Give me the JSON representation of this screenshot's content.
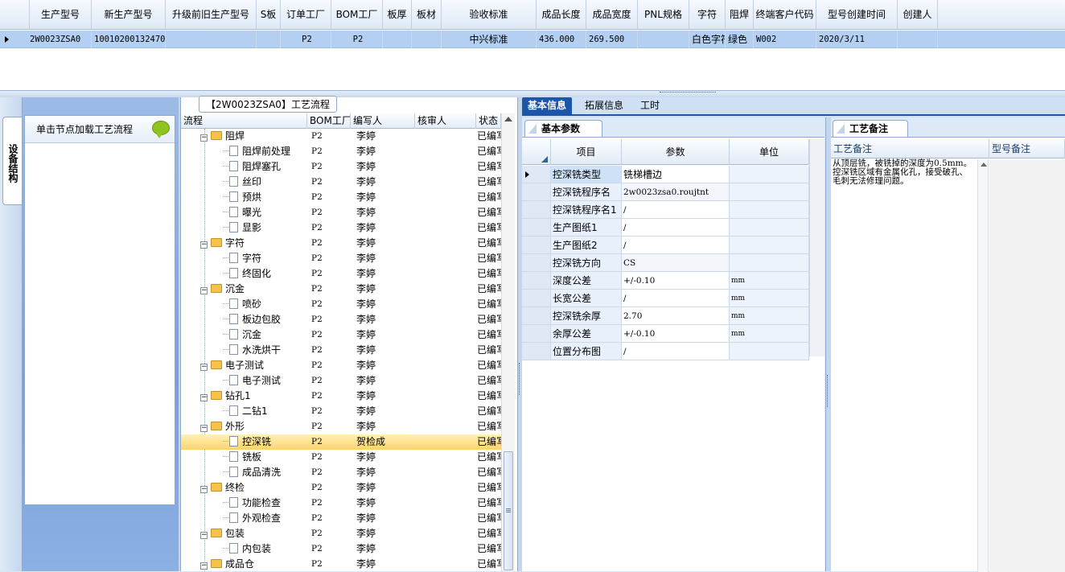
{
  "top_grid": {
    "columns": [
      "生产型号",
      "新生产型号",
      "升级前旧生产型号",
      "S板",
      "订单工厂",
      "BOM工厂",
      "板厚",
      "板材",
      "验收标准",
      "成品长度",
      "成品宽度",
      "PNL规格",
      "字符",
      "阻焊",
      "终端客户代码",
      "型号创建时间",
      "创建人"
    ],
    "row": {
      "production_model": "2W0023ZSA0",
      "new_production_model": "10010200132470",
      "old_production_model": "",
      "s_board": "",
      "order_factory": "P2",
      "bom_factory": "P2",
      "thickness": "",
      "material": "",
      "acceptance_standard": "中兴标准",
      "length": "436.000",
      "width": "269.500",
      "pnl_spec": "",
      "legend": "白色字符",
      "solder_mask": "绿色",
      "customer_code": "W002",
      "created_time": "2020/3/11",
      "creator": ""
    }
  },
  "left_strip": {
    "tab_label": "设备结构"
  },
  "left_panel": {
    "header": "单击节点加载工艺流程"
  },
  "tree": {
    "caption": "【2W0023ZSA0】工艺流程",
    "columns": [
      "流程",
      "BOM工厂",
      "编写人",
      "核审人",
      "状态"
    ],
    "rows": [
      {
        "name": "阻焊",
        "level": 1,
        "bom": "P2",
        "writer": "李婷",
        "reviewer": "",
        "status": "已编写"
      },
      {
        "name": "阻焊前处理",
        "level": 2,
        "bom": "P2",
        "writer": "李婷",
        "reviewer": "",
        "status": "已编写"
      },
      {
        "name": "阻焊塞孔",
        "level": 2,
        "bom": "P2",
        "writer": "李婷",
        "reviewer": "",
        "status": "已编写"
      },
      {
        "name": "丝印",
        "level": 2,
        "bom": "P2",
        "writer": "李婷",
        "reviewer": "",
        "status": "已编写"
      },
      {
        "name": "预烘",
        "level": 2,
        "bom": "P2",
        "writer": "李婷",
        "reviewer": "",
        "status": "已编写"
      },
      {
        "name": "曝光",
        "level": 2,
        "bom": "P2",
        "writer": "李婷",
        "reviewer": "",
        "status": "已编写"
      },
      {
        "name": "显影",
        "level": 2,
        "bom": "P2",
        "writer": "李婷",
        "reviewer": "",
        "status": "已编写"
      },
      {
        "name": "字符",
        "level": 1,
        "bom": "P2",
        "writer": "李婷",
        "reviewer": "",
        "status": "已编写"
      },
      {
        "name": "字符",
        "level": 2,
        "bom": "P2",
        "writer": "李婷",
        "reviewer": "",
        "status": "已编写"
      },
      {
        "name": "终固化",
        "level": 2,
        "bom": "P2",
        "writer": "李婷",
        "reviewer": "",
        "status": "已编写"
      },
      {
        "name": "沉金",
        "level": 1,
        "bom": "P2",
        "writer": "李婷",
        "reviewer": "",
        "status": "已编写"
      },
      {
        "name": "喷砂",
        "level": 2,
        "bom": "P2",
        "writer": "李婷",
        "reviewer": "",
        "status": "已编写"
      },
      {
        "name": "板边包胶",
        "level": 2,
        "bom": "P2",
        "writer": "李婷",
        "reviewer": "",
        "status": "已编写"
      },
      {
        "name": "沉金",
        "level": 2,
        "bom": "P2",
        "writer": "李婷",
        "reviewer": "",
        "status": "已编写"
      },
      {
        "name": "水洗烘干",
        "level": 2,
        "bom": "P2",
        "writer": "李婷",
        "reviewer": "",
        "status": "已编写"
      },
      {
        "name": "电子测试",
        "level": 1,
        "bom": "P2",
        "writer": "李婷",
        "reviewer": "",
        "status": "已编写"
      },
      {
        "name": "电子测试",
        "level": 2,
        "bom": "P2",
        "writer": "李婷",
        "reviewer": "",
        "status": "已编写"
      },
      {
        "name": "钻孔1",
        "level": 1,
        "bom": "P2",
        "writer": "李婷",
        "reviewer": "",
        "status": "已编写"
      },
      {
        "name": "二钻1",
        "level": 2,
        "bom": "P2",
        "writer": "李婷",
        "reviewer": "",
        "status": "已编写"
      },
      {
        "name": "外形",
        "level": 1,
        "bom": "P2",
        "writer": "李婷",
        "reviewer": "",
        "status": "已编写"
      },
      {
        "name": "控深铣",
        "level": 2,
        "bom": "P2",
        "writer": "贺检成",
        "reviewer": "",
        "status": "已编写",
        "selected": true
      },
      {
        "name": "铣板",
        "level": 2,
        "bom": "P2",
        "writer": "李婷",
        "reviewer": "",
        "status": "已编写"
      },
      {
        "name": "成品清洗",
        "level": 2,
        "bom": "P2",
        "writer": "李婷",
        "reviewer": "",
        "status": "已编写"
      },
      {
        "name": "终检",
        "level": 1,
        "bom": "P2",
        "writer": "李婷",
        "reviewer": "",
        "status": "已编写"
      },
      {
        "name": "功能检查",
        "level": 2,
        "bom": "P2",
        "writer": "李婷",
        "reviewer": "",
        "status": "已编写"
      },
      {
        "name": "外观检查",
        "level": 2,
        "bom": "P2",
        "writer": "李婷",
        "reviewer": "",
        "status": "已编写"
      },
      {
        "name": "包装",
        "level": 1,
        "bom": "P2",
        "writer": "李婷",
        "reviewer": "",
        "status": "已编写"
      },
      {
        "name": "内包装",
        "level": 2,
        "bom": "P2",
        "writer": "李婷",
        "reviewer": "",
        "status": "已编写"
      },
      {
        "name": "成品仓",
        "level": 1,
        "bom": "P2",
        "writer": "李婷",
        "reviewer": "",
        "status": "已编写"
      }
    ]
  },
  "main_tabs": [
    "基本信息",
    "拓展信息",
    "工时"
  ],
  "params": {
    "tab_label": "基本参数",
    "columns": [
      "项目",
      "参数",
      "单位"
    ],
    "rows": [
      {
        "item": "控深铣类型",
        "value": "铣梯槽边",
        "unit": ""
      },
      {
        "item": "控深铣程序名",
        "value": "2w0023zsa0.roujtnt",
        "unit": ""
      },
      {
        "item": "控深铣程序名1",
        "value": "/",
        "unit": ""
      },
      {
        "item": "生产图纸1",
        "value": "/",
        "unit": ""
      },
      {
        "item": "生产图纸2",
        "value": "/",
        "unit": ""
      },
      {
        "item": "控深铣方向",
        "value": "CS",
        "unit": ""
      },
      {
        "item": "深度公差",
        "value": "+/-0.10",
        "unit": "mm"
      },
      {
        "item": "长宽公差",
        "value": "/",
        "unit": "mm"
      },
      {
        "item": "控深铣余厚",
        "value": "2.70",
        "unit": "mm"
      },
      {
        "item": "余厚公差",
        "value": "+/-0.10",
        "unit": "mm"
      },
      {
        "item": "位置分布图",
        "value": "/",
        "unit": ""
      }
    ]
  },
  "notes": {
    "tab_label": "工艺备注",
    "columns": [
      "工艺备注",
      "型号备注"
    ],
    "process_note": "从顶层铣，被铣掉的深度为0.5mm。控深铣区域有金属化孔，接受破孔、毛刺无法修理问题。",
    "model_note": ""
  }
}
